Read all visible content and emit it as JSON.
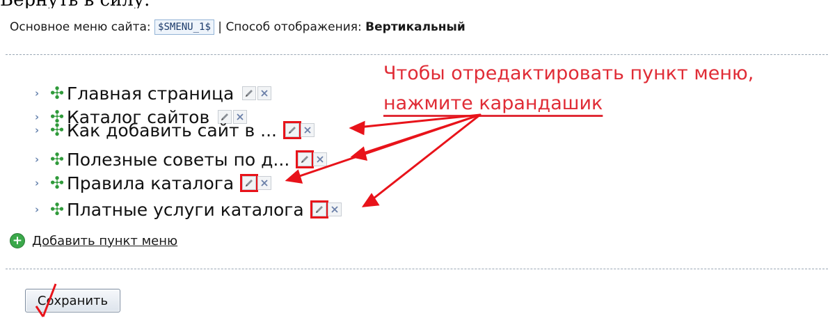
{
  "top_text": "Вернуть в силу.",
  "header": {
    "menu_label": "Основное меню сайта:",
    "menu_code": "$SMENU_1$",
    "separator": "|",
    "mode_label": "Способ отображения:",
    "mode_value": "Вертикальный"
  },
  "menu_items": [
    {
      "label": "Главная страница"
    },
    {
      "label": "Каталог сайтов"
    },
    {
      "label": "Как добавить сайт в ..."
    },
    {
      "label": "Полезные советы по д..."
    },
    {
      "label": "Правила каталога"
    },
    {
      "label": "Платные услуги каталога"
    }
  ],
  "add_item": {
    "label": "Добавить пункт меню"
  },
  "save_button": {
    "label": "Сохранить"
  },
  "annotation": {
    "line1": "Чтобы отредактировать пункт меню,",
    "line2": "нажмите карандашик"
  },
  "icons": {
    "chevron": "chevron-right-icon",
    "cross": "green-cross-icon",
    "edit": "pencil-icon",
    "delete": "x-delete-icon",
    "add": "plus-circle-icon"
  },
  "colors": {
    "annotation_red": "#e02c36",
    "green": "#2f9a3a",
    "dashed_line": "#9aa7b5"
  }
}
